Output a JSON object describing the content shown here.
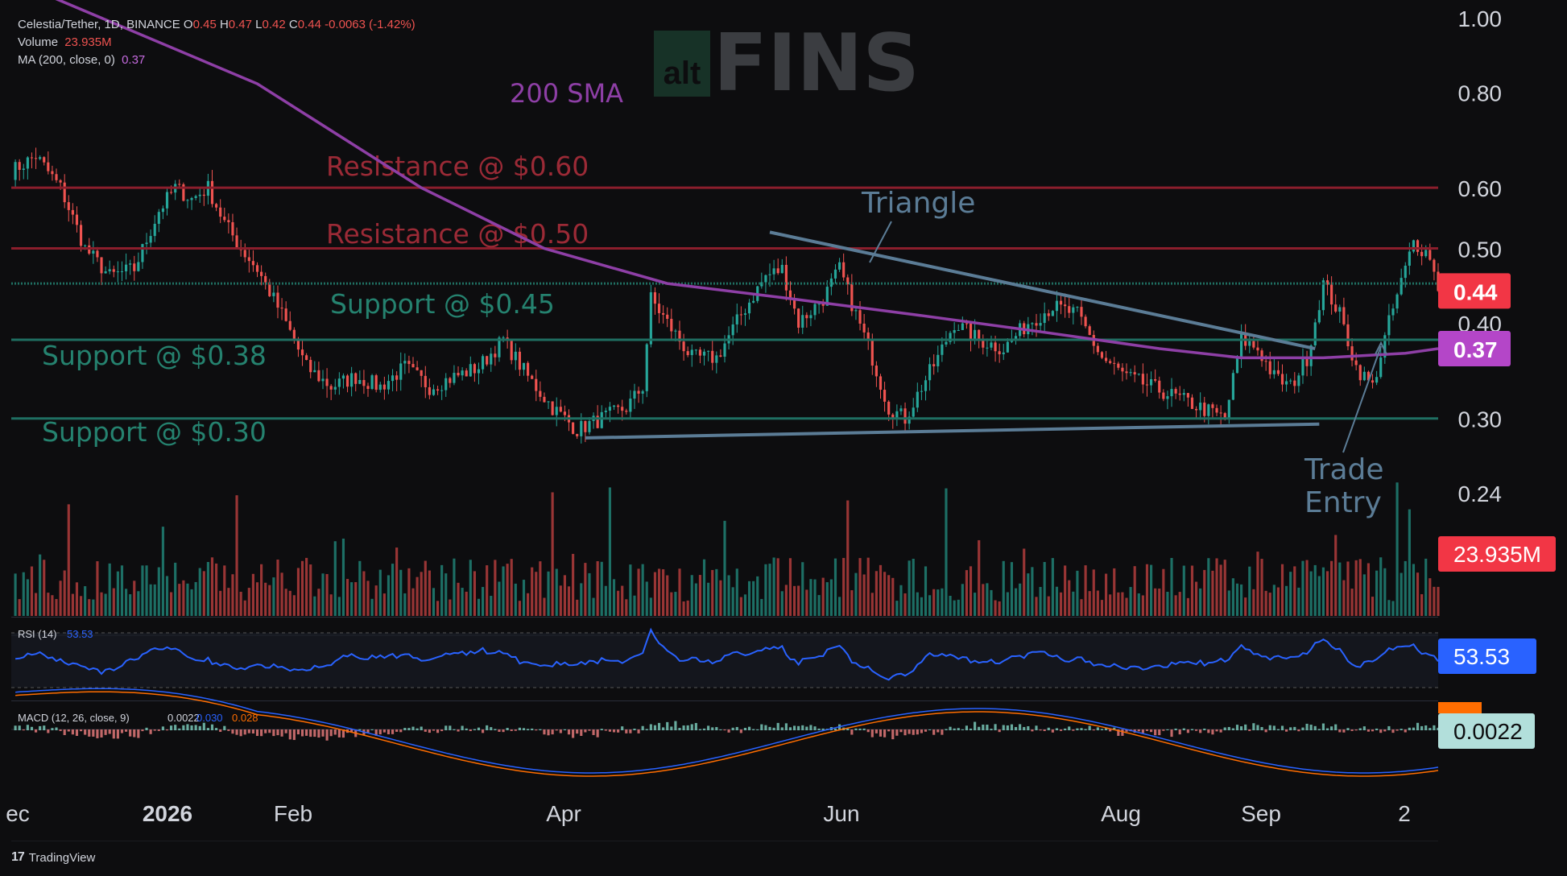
{
  "header": {
    "title": "Celestia/Tether, 1D, BINANCE",
    "ohlc": [
      {
        "k": "O",
        "v": "0.45"
      },
      {
        "k": "H",
        "v": "0.47"
      },
      {
        "k": "L",
        "v": "0.42"
      },
      {
        "k": "C",
        "v": "0.44"
      }
    ],
    "change": "-0.0063 (-1.42%)",
    "volume_label": "Volume",
    "volume_value": "23.935M",
    "ma_label": "MA (200, close, 0)",
    "ma_value": "0.37"
  },
  "watermark": {
    "box": "alt",
    "text": "FINS"
  },
  "footer": {
    "brand": "TradingView"
  },
  "colors": {
    "background": "#0d0d0f",
    "up": "#26a69a",
    "down": "#ef5350",
    "sma": "#8e3fa6",
    "resistance": "#8b1e2c",
    "support": "#1f6f62",
    "trend": "#5b7c96",
    "rsi": "#2962ff",
    "macd": "#2962ff",
    "signal": "#ff6d00"
  },
  "chart_data": {
    "type": "candlestick",
    "symbol": "Celestia/Tether",
    "interval": "1D",
    "exchange": "BINANCE",
    "price_scale": "log",
    "ylim": [
      0.21,
      1.0
    ],
    "price_ticks": [
      "1.00",
      "0.80",
      "0.60",
      "0.50",
      "0.40",
      "0.30",
      "0.24"
    ],
    "x_ticks": [
      "ec",
      "2026",
      "Feb",
      "Apr",
      "Jun",
      "Aug",
      "Sep",
      "2"
    ],
    "price_path": [
      {
        "t": 0,
        "p": 0.63
      },
      {
        "t": 6,
        "p": 0.66
      },
      {
        "t": 12,
        "p": 0.6
      },
      {
        "t": 18,
        "p": 0.5
      },
      {
        "t": 24,
        "p": 0.46
      },
      {
        "t": 30,
        "p": 0.47
      },
      {
        "t": 36,
        "p": 0.56
      },
      {
        "t": 40,
        "p": 0.6
      },
      {
        "t": 44,
        "p": 0.58
      },
      {
        "t": 48,
        "p": 0.6
      },
      {
        "t": 52,
        "p": 0.54
      },
      {
        "t": 56,
        "p": 0.5
      },
      {
        "t": 60,
        "p": 0.47
      },
      {
        "t": 66,
        "p": 0.41
      },
      {
        "t": 72,
        "p": 0.35
      },
      {
        "t": 78,
        "p": 0.33
      },
      {
        "t": 84,
        "p": 0.34
      },
      {
        "t": 90,
        "p": 0.33
      },
      {
        "t": 96,
        "p": 0.35
      },
      {
        "t": 102,
        "p": 0.33
      },
      {
        "t": 108,
        "p": 0.34
      },
      {
        "t": 114,
        "p": 0.35
      },
      {
        "t": 120,
        "p": 0.38
      },
      {
        "t": 126,
        "p": 0.34
      },
      {
        "t": 132,
        "p": 0.31
      },
      {
        "t": 138,
        "p": 0.29
      },
      {
        "t": 144,
        "p": 0.3
      },
      {
        "t": 150,
        "p": 0.31
      },
      {
        "t": 154,
        "p": 0.33
      },
      {
        "t": 156,
        "p": 0.43
      },
      {
        "t": 160,
        "p": 0.4
      },
      {
        "t": 166,
        "p": 0.36
      },
      {
        "t": 172,
        "p": 0.36
      },
      {
        "t": 178,
        "p": 0.41
      },
      {
        "t": 184,
        "p": 0.46
      },
      {
        "t": 188,
        "p": 0.47
      },
      {
        "t": 192,
        "p": 0.4
      },
      {
        "t": 198,
        "p": 0.43
      },
      {
        "t": 202,
        "p": 0.47
      },
      {
        "t": 206,
        "p": 0.41
      },
      {
        "t": 210,
        "p": 0.36
      },
      {
        "t": 214,
        "p": 0.31
      },
      {
        "t": 218,
        "p": 0.3
      },
      {
        "t": 222,
        "p": 0.33
      },
      {
        "t": 226,
        "p": 0.36
      },
      {
        "t": 230,
        "p": 0.4
      },
      {
        "t": 236,
        "p": 0.38
      },
      {
        "t": 242,
        "p": 0.37
      },
      {
        "t": 248,
        "p": 0.4
      },
      {
        "t": 254,
        "p": 0.42
      },
      {
        "t": 260,
        "p": 0.41
      },
      {
        "t": 266,
        "p": 0.36
      },
      {
        "t": 272,
        "p": 0.34
      },
      {
        "t": 278,
        "p": 0.33
      },
      {
        "t": 284,
        "p": 0.32
      },
      {
        "t": 290,
        "p": 0.31
      },
      {
        "t": 296,
        "p": 0.3
      },
      {
        "t": 300,
        "p": 0.38
      },
      {
        "t": 304,
        "p": 0.37
      },
      {
        "t": 308,
        "p": 0.34
      },
      {
        "t": 312,
        "p": 0.33
      },
      {
        "t": 316,
        "p": 0.36
      },
      {
        "t": 320,
        "p": 0.45
      },
      {
        "t": 324,
        "p": 0.41
      },
      {
        "t": 328,
        "p": 0.35
      },
      {
        "t": 332,
        "p": 0.33
      },
      {
        "t": 336,
        "p": 0.4
      },
      {
        "t": 340,
        "p": 0.47
      },
      {
        "t": 342,
        "p": 0.51
      },
      {
        "t": 346,
        "p": 0.49
      },
      {
        "t": 348,
        "p": 0.44
      }
    ],
    "sma_path": [
      {
        "t": 0,
        "p": 1.12
      },
      {
        "t": 60,
        "p": 0.82
      },
      {
        "t": 100,
        "p": 0.6
      },
      {
        "t": 130,
        "p": 0.5
      },
      {
        "t": 160,
        "p": 0.45
      },
      {
        "t": 190,
        "p": 0.43
      },
      {
        "t": 220,
        "p": 0.41
      },
      {
        "t": 250,
        "p": 0.39
      },
      {
        "t": 280,
        "p": 0.37
      },
      {
        "t": 300,
        "p": 0.36
      },
      {
        "t": 320,
        "p": 0.36
      },
      {
        "t": 340,
        "p": 0.365
      },
      {
        "t": 348,
        "p": 0.37
      }
    ],
    "levels": [
      {
        "name": "Resistance @ $0.60",
        "price": 0.6,
        "kind": "resistance"
      },
      {
        "name": "Resistance @ $0.50",
        "price": 0.5,
        "kind": "resistance"
      },
      {
        "name": "Support @ $0.45",
        "price": 0.45,
        "kind": "support"
      },
      {
        "name": "Support @ $0.38",
        "price": 0.38,
        "kind": "support"
      },
      {
        "name": "Support @ $0.30",
        "price": 0.3,
        "kind": "support"
      }
    ],
    "annotations": [
      "200 SMA",
      "Triangle",
      "Trade",
      "Entry"
    ],
    "price_labels": [
      {
        "text": "0.44",
        "price": 0.44,
        "color": "#f23645"
      },
      {
        "text": "0.37",
        "price": 0.37,
        "color": "#b446c8"
      }
    ],
    "volume": {
      "last": "23.935M",
      "last_color": "#f23645"
    },
    "rsi": {
      "label": "RSI (14)",
      "value": "53.53",
      "levels": [
        70,
        30
      ]
    },
    "macd": {
      "label": "MACD (12, 26, close, 9)",
      "macd": "0.0022",
      "signal": "0.030",
      "hist": "0.028",
      "label_value": "0.0022"
    }
  }
}
